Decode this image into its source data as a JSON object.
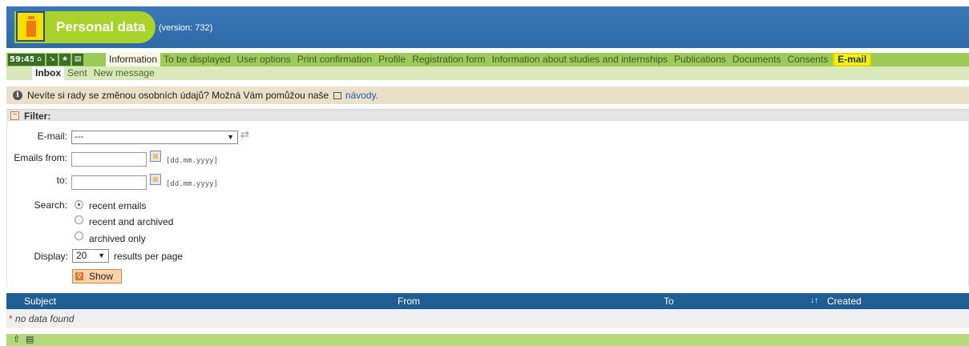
{
  "header": {
    "title": "Personal data",
    "version": "(version: 732)",
    "colors": {
      "header_bg": "#2f6aa8",
      "highlight": "#a9d22a"
    }
  },
  "nav": {
    "timer": "59:45",
    "icons": [
      "home-icon",
      "bookmark-down-icon",
      "star-icon",
      "print-icon"
    ],
    "tabs": [
      {
        "label": "Information",
        "active": true
      },
      {
        "label": "To be displayed"
      },
      {
        "label": "User options"
      },
      {
        "label": "Print confirmation"
      },
      {
        "label": "Profile"
      },
      {
        "label": "Registration form"
      },
      {
        "label": "Information about studies and internships"
      },
      {
        "label": "Publications"
      },
      {
        "label": "Documents"
      },
      {
        "label": "Consents"
      },
      {
        "label": "E-mail",
        "highlighted": true
      }
    ]
  },
  "subnav": {
    "tabs": [
      {
        "label": "Inbox",
        "active": true
      },
      {
        "label": "Sent"
      },
      {
        "label": "New message"
      }
    ]
  },
  "info": {
    "text": "Nevíte si rady se změnou osobních údajů? Možná Vám pomůžou naše",
    "link": "návody."
  },
  "filter": {
    "title": "Filter:",
    "email_label": "E-mail:",
    "email_value": "---",
    "from_label": "Emails from:",
    "to_label": "to:",
    "date_placeholder": "",
    "date_format": "[dd.mm.yyyy]",
    "search_label": "Search:",
    "search_options": [
      {
        "label": "recent emails",
        "selected": true
      },
      {
        "label": "recent and archived",
        "selected": false
      },
      {
        "label": "archived only",
        "selected": false
      }
    ],
    "display_label": "Display:",
    "display_value": "20",
    "display_suffix": "results per page",
    "show_button": "Show"
  },
  "table": {
    "columns": [
      "Subject",
      "From",
      "To",
      "Created"
    ],
    "sort_icon": "↓↑",
    "empty_star": "*",
    "empty_text": "no data found"
  }
}
